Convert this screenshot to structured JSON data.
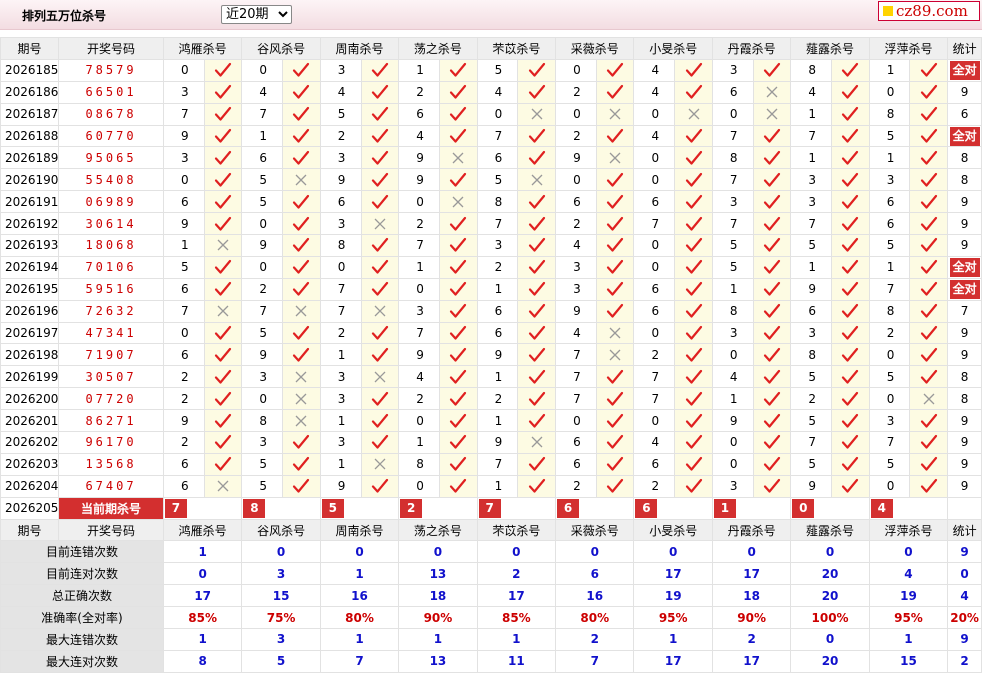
{
  "header": {
    "title": "排列五万位杀号",
    "period_selected": "近20期",
    "logo_text": "cz89.com"
  },
  "columns": {
    "issue": "期号",
    "open": "开奖号码",
    "experts": [
      "鸿雁杀号",
      "谷风杀号",
      "周南杀号",
      "荡之杀号",
      "芣苡杀号",
      "采薇杀号",
      "小旻杀号",
      "丹霞杀号",
      "薤露杀号",
      "浮萍杀号"
    ],
    "stat": "统计"
  },
  "rows": [
    {
      "issue": "2026185",
      "open": "78579",
      "k": [
        [
          0,
          1
        ],
        [
          0,
          1
        ],
        [
          3,
          1
        ],
        [
          1,
          1
        ],
        [
          5,
          1
        ],
        [
          0,
          1
        ],
        [
          4,
          1
        ],
        [
          3,
          1
        ],
        [
          8,
          1
        ],
        [
          1,
          1
        ]
      ],
      "stat": "全对"
    },
    {
      "issue": "2026186",
      "open": "66501",
      "k": [
        [
          3,
          1
        ],
        [
          4,
          1
        ],
        [
          4,
          1
        ],
        [
          2,
          1
        ],
        [
          4,
          1
        ],
        [
          2,
          1
        ],
        [
          4,
          1
        ],
        [
          6,
          0
        ],
        [
          4,
          1
        ],
        [
          0,
          1
        ]
      ],
      "stat": "9"
    },
    {
      "issue": "2026187",
      "open": "08678",
      "k": [
        [
          7,
          1
        ],
        [
          7,
          1
        ],
        [
          5,
          1
        ],
        [
          6,
          1
        ],
        [
          0,
          0
        ],
        [
          0,
          0
        ],
        [
          0,
          0
        ],
        [
          0,
          0
        ],
        [
          1,
          1
        ],
        [
          8,
          1
        ]
      ],
      "stat": "6"
    },
    {
      "issue": "2026188",
      "open": "60770",
      "k": [
        [
          9,
          1
        ],
        [
          1,
          1
        ],
        [
          2,
          1
        ],
        [
          4,
          1
        ],
        [
          7,
          1
        ],
        [
          2,
          1
        ],
        [
          4,
          1
        ],
        [
          7,
          1
        ],
        [
          7,
          1
        ],
        [
          5,
          1
        ]
      ],
      "stat": "全对"
    },
    {
      "issue": "2026189",
      "open": "95065",
      "k": [
        [
          3,
          1
        ],
        [
          6,
          1
        ],
        [
          3,
          1
        ],
        [
          9,
          0
        ],
        [
          6,
          1
        ],
        [
          9,
          0
        ],
        [
          0,
          1
        ],
        [
          8,
          1
        ],
        [
          1,
          1
        ],
        [
          1,
          1
        ]
      ],
      "stat": "8"
    },
    {
      "issue": "2026190",
      "open": "55408",
      "k": [
        [
          0,
          1
        ],
        [
          5,
          0
        ],
        [
          9,
          1
        ],
        [
          9,
          1
        ],
        [
          5,
          0
        ],
        [
          0,
          1
        ],
        [
          0,
          1
        ],
        [
          7,
          1
        ],
        [
          3,
          1
        ],
        [
          3,
          1
        ]
      ],
      "stat": "8"
    },
    {
      "issue": "2026191",
      "open": "06989",
      "k": [
        [
          6,
          1
        ],
        [
          5,
          1
        ],
        [
          6,
          1
        ],
        [
          0,
          0
        ],
        [
          8,
          1
        ],
        [
          6,
          1
        ],
        [
          6,
          1
        ],
        [
          3,
          1
        ],
        [
          3,
          1
        ],
        [
          6,
          1
        ]
      ],
      "stat": "9"
    },
    {
      "issue": "2026192",
      "open": "30614",
      "k": [
        [
          9,
          1
        ],
        [
          0,
          1
        ],
        [
          3,
          0
        ],
        [
          2,
          1
        ],
        [
          7,
          1
        ],
        [
          2,
          1
        ],
        [
          7,
          1
        ],
        [
          7,
          1
        ],
        [
          7,
          1
        ],
        [
          6,
          1
        ]
      ],
      "stat": "9"
    },
    {
      "issue": "2026193",
      "open": "18068",
      "k": [
        [
          1,
          0
        ],
        [
          9,
          1
        ],
        [
          8,
          1
        ],
        [
          7,
          1
        ],
        [
          3,
          1
        ],
        [
          4,
          1
        ],
        [
          0,
          1
        ],
        [
          5,
          1
        ],
        [
          5,
          1
        ],
        [
          5,
          1
        ]
      ],
      "stat": "9"
    },
    {
      "issue": "2026194",
      "open": "70106",
      "k": [
        [
          5,
          1
        ],
        [
          0,
          1
        ],
        [
          0,
          1
        ],
        [
          1,
          1
        ],
        [
          2,
          1
        ],
        [
          3,
          1
        ],
        [
          0,
          1
        ],
        [
          5,
          1
        ],
        [
          1,
          1
        ],
        [
          1,
          1
        ]
      ],
      "stat": "全对"
    },
    {
      "issue": "2026195",
      "open": "59516",
      "k": [
        [
          6,
          1
        ],
        [
          2,
          1
        ],
        [
          7,
          1
        ],
        [
          0,
          1
        ],
        [
          1,
          1
        ],
        [
          3,
          1
        ],
        [
          6,
          1
        ],
        [
          1,
          1
        ],
        [
          9,
          1
        ],
        [
          7,
          1
        ]
      ],
      "stat": "全对"
    },
    {
      "issue": "2026196",
      "open": "72632",
      "k": [
        [
          7,
          0
        ],
        [
          7,
          0
        ],
        [
          7,
          0
        ],
        [
          3,
          1
        ],
        [
          6,
          1
        ],
        [
          9,
          1
        ],
        [
          6,
          1
        ],
        [
          8,
          1
        ],
        [
          6,
          1
        ],
        [
          8,
          1
        ]
      ],
      "stat": "7"
    },
    {
      "issue": "2026197",
      "open": "47341",
      "k": [
        [
          0,
          1
        ],
        [
          5,
          1
        ],
        [
          2,
          1
        ],
        [
          7,
          1
        ],
        [
          6,
          1
        ],
        [
          4,
          0
        ],
        [
          0,
          1
        ],
        [
          3,
          1
        ],
        [
          3,
          1
        ],
        [
          2,
          1
        ]
      ],
      "stat": "9"
    },
    {
      "issue": "2026198",
      "open": "71907",
      "k": [
        [
          6,
          1
        ],
        [
          9,
          1
        ],
        [
          1,
          1
        ],
        [
          9,
          1
        ],
        [
          9,
          1
        ],
        [
          7,
          0
        ],
        [
          2,
          1
        ],
        [
          0,
          1
        ],
        [
          8,
          1
        ],
        [
          0,
          1
        ]
      ],
      "stat": "9"
    },
    {
      "issue": "2026199",
      "open": "30507",
      "k": [
        [
          2,
          1
        ],
        [
          3,
          0
        ],
        [
          3,
          0
        ],
        [
          4,
          1
        ],
        [
          1,
          1
        ],
        [
          7,
          1
        ],
        [
          7,
          1
        ],
        [
          4,
          1
        ],
        [
          5,
          1
        ],
        [
          5,
          1
        ]
      ],
      "stat": "8"
    },
    {
      "issue": "2026200",
      "open": "07720",
      "k": [
        [
          2,
          1
        ],
        [
          0,
          0
        ],
        [
          3,
          1
        ],
        [
          2,
          1
        ],
        [
          2,
          1
        ],
        [
          7,
          1
        ],
        [
          7,
          1
        ],
        [
          1,
          1
        ],
        [
          2,
          1
        ],
        [
          0,
          0
        ]
      ],
      "stat": "8"
    },
    {
      "issue": "2026201",
      "open": "86271",
      "k": [
        [
          9,
          1
        ],
        [
          8,
          0
        ],
        [
          1,
          1
        ],
        [
          0,
          1
        ],
        [
          1,
          1
        ],
        [
          0,
          1
        ],
        [
          0,
          1
        ],
        [
          9,
          1
        ],
        [
          5,
          1
        ],
        [
          3,
          1
        ]
      ],
      "stat": "9"
    },
    {
      "issue": "2026202",
      "open": "96170",
      "k": [
        [
          2,
          1
        ],
        [
          3,
          1
        ],
        [
          3,
          1
        ],
        [
          1,
          1
        ],
        [
          9,
          0
        ],
        [
          6,
          1
        ],
        [
          4,
          1
        ],
        [
          0,
          1
        ],
        [
          7,
          1
        ],
        [
          7,
          1
        ]
      ],
      "stat": "9"
    },
    {
      "issue": "2026203",
      "open": "13568",
      "k": [
        [
          6,
          1
        ],
        [
          5,
          1
        ],
        [
          1,
          0
        ],
        [
          8,
          1
        ],
        [
          7,
          1
        ],
        [
          6,
          1
        ],
        [
          6,
          1
        ],
        [
          0,
          1
        ],
        [
          5,
          1
        ],
        [
          5,
          1
        ]
      ],
      "stat": "9"
    },
    {
      "issue": "2026204",
      "open": "67407",
      "k": [
        [
          6,
          0
        ],
        [
          5,
          1
        ],
        [
          9,
          1
        ],
        [
          0,
          1
        ],
        [
          1,
          1
        ],
        [
          2,
          1
        ],
        [
          2,
          1
        ],
        [
          3,
          1
        ],
        [
          9,
          1
        ],
        [
          0,
          1
        ]
      ],
      "stat": "9"
    }
  ],
  "current": {
    "issue": "2026205",
    "label": "当前期杀号",
    "kills": [
      "7",
      "8",
      "5",
      "2",
      "7",
      "6",
      "6",
      "1",
      "0",
      "4"
    ]
  },
  "stats": [
    {
      "label": "目前连错次数",
      "values": [
        "1",
        "0",
        "0",
        "0",
        "0",
        "0",
        "0",
        "0",
        "0",
        "0"
      ],
      "stat": "9",
      "red": false
    },
    {
      "label": "目前连对次数",
      "values": [
        "0",
        "3",
        "1",
        "13",
        "2",
        "6",
        "17",
        "17",
        "20",
        "4"
      ],
      "stat": "0",
      "red": false
    },
    {
      "label": "总正确次数",
      "values": [
        "17",
        "15",
        "16",
        "18",
        "17",
        "16",
        "19",
        "18",
        "20",
        "19"
      ],
      "stat": "4",
      "red": false
    },
    {
      "label": "准确率(全对率)",
      "values": [
        "85%",
        "75%",
        "80%",
        "90%",
        "85%",
        "80%",
        "95%",
        "90%",
        "100%",
        "95%"
      ],
      "stat": "20%",
      "red": true
    },
    {
      "label": "最大连错次数",
      "values": [
        "1",
        "3",
        "1",
        "1",
        "1",
        "2",
        "1",
        "2",
        "0",
        "1"
      ],
      "stat": "9",
      "red": false
    },
    {
      "label": "最大连对次数",
      "values": [
        "8",
        "5",
        "7",
        "13",
        "11",
        "7",
        "17",
        "17",
        "20",
        "15"
      ],
      "stat": "2",
      "red": false
    }
  ],
  "icons": {
    "correct": "check-icon",
    "wrong": "cross-icon"
  },
  "colors": {
    "accent": "#d32f2f",
    "check": "#e02020",
    "cross": "#999999",
    "stat_blue": "#1111cc",
    "header_bg": "#efefef",
    "icon_cell_bg": "#fdfbe3"
  }
}
